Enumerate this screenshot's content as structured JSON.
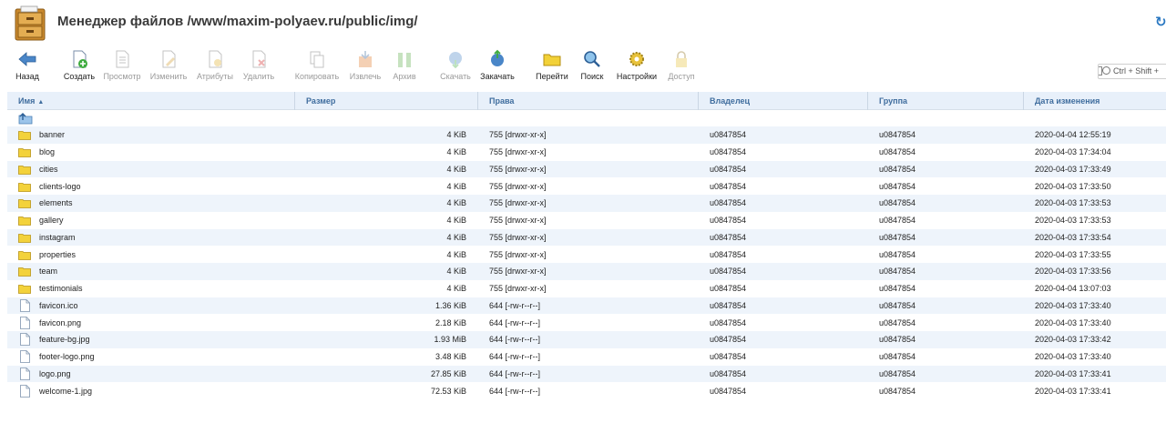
{
  "header": {
    "title": "Менеджер файлов /www/maxim-polyaev.ru/public/img/"
  },
  "toolbar": {
    "back": "Назад",
    "create": "Создать",
    "view": "Просмотр",
    "edit": "Изменить",
    "attributes": "Атрибуты",
    "delete": "Удалить",
    "copy": "Копировать",
    "extract": "Извлечь",
    "archive": "Архив",
    "download": "Скачать",
    "upload": "Закачать",
    "goto": "Перейти",
    "search": "Поиск",
    "settings": "Настройки",
    "access": "Доступ"
  },
  "search_box": {
    "text": "Ctrl + Shift +"
  },
  "columns": {
    "name": "Имя",
    "size": "Размер",
    "rights": "Права",
    "owner": "Владелец",
    "group": "Группа",
    "modified": "Дата изменения"
  },
  "files": [
    {
      "type": "folder",
      "name": "banner",
      "size": "4 KiB",
      "rights": "755 [drwxr-xr-x]",
      "owner": "u0847854",
      "group": "u0847854",
      "modified": "2020-04-04 12:55:19"
    },
    {
      "type": "folder",
      "name": "blog",
      "size": "4 KiB",
      "rights": "755 [drwxr-xr-x]",
      "owner": "u0847854",
      "group": "u0847854",
      "modified": "2020-04-03 17:34:04"
    },
    {
      "type": "folder",
      "name": "cities",
      "size": "4 KiB",
      "rights": "755 [drwxr-xr-x]",
      "owner": "u0847854",
      "group": "u0847854",
      "modified": "2020-04-03 17:33:49"
    },
    {
      "type": "folder",
      "name": "clients-logo",
      "size": "4 KiB",
      "rights": "755 [drwxr-xr-x]",
      "owner": "u0847854",
      "group": "u0847854",
      "modified": "2020-04-03 17:33:50"
    },
    {
      "type": "folder",
      "name": "elements",
      "size": "4 KiB",
      "rights": "755 [drwxr-xr-x]",
      "owner": "u0847854",
      "group": "u0847854",
      "modified": "2020-04-03 17:33:53"
    },
    {
      "type": "folder",
      "name": "gallery",
      "size": "4 KiB",
      "rights": "755 [drwxr-xr-x]",
      "owner": "u0847854",
      "group": "u0847854",
      "modified": "2020-04-03 17:33:53"
    },
    {
      "type": "folder",
      "name": "instagram",
      "size": "4 KiB",
      "rights": "755 [drwxr-xr-x]",
      "owner": "u0847854",
      "group": "u0847854",
      "modified": "2020-04-03 17:33:54"
    },
    {
      "type": "folder",
      "name": "properties",
      "size": "4 KiB",
      "rights": "755 [drwxr-xr-x]",
      "owner": "u0847854",
      "group": "u0847854",
      "modified": "2020-04-03 17:33:55"
    },
    {
      "type": "folder",
      "name": "team",
      "size": "4 KiB",
      "rights": "755 [drwxr-xr-x]",
      "owner": "u0847854",
      "group": "u0847854",
      "modified": "2020-04-03 17:33:56"
    },
    {
      "type": "folder",
      "name": "testimonials",
      "size": "4 KiB",
      "rights": "755 [drwxr-xr-x]",
      "owner": "u0847854",
      "group": "u0847854",
      "modified": "2020-04-04 13:07:03"
    },
    {
      "type": "file",
      "name": "favicon.ico",
      "size": "1.36 KiB",
      "rights": "644 [-rw-r--r--]",
      "owner": "u0847854",
      "group": "u0847854",
      "modified": "2020-04-03 17:33:40"
    },
    {
      "type": "file",
      "name": "favicon.png",
      "size": "2.18 KiB",
      "rights": "644 [-rw-r--r--]",
      "owner": "u0847854",
      "group": "u0847854",
      "modified": "2020-04-03 17:33:40"
    },
    {
      "type": "file",
      "name": "feature-bg.jpg",
      "size": "1.93 MiB",
      "rights": "644 [-rw-r--r--]",
      "owner": "u0847854",
      "group": "u0847854",
      "modified": "2020-04-03 17:33:42"
    },
    {
      "type": "file",
      "name": "footer-logo.png",
      "size": "3.48 KiB",
      "rights": "644 [-rw-r--r--]",
      "owner": "u0847854",
      "group": "u0847854",
      "modified": "2020-04-03 17:33:40"
    },
    {
      "type": "file",
      "name": "logo.png",
      "size": "27.85 KiB",
      "rights": "644 [-rw-r--r--]",
      "owner": "u0847854",
      "group": "u0847854",
      "modified": "2020-04-03 17:33:41"
    },
    {
      "type": "file",
      "name": "welcome-1.jpg",
      "size": "72.53 KiB",
      "rights": "644 [-rw-r--r--]",
      "owner": "u0847854",
      "group": "u0847854",
      "modified": "2020-04-03 17:33:41"
    }
  ]
}
